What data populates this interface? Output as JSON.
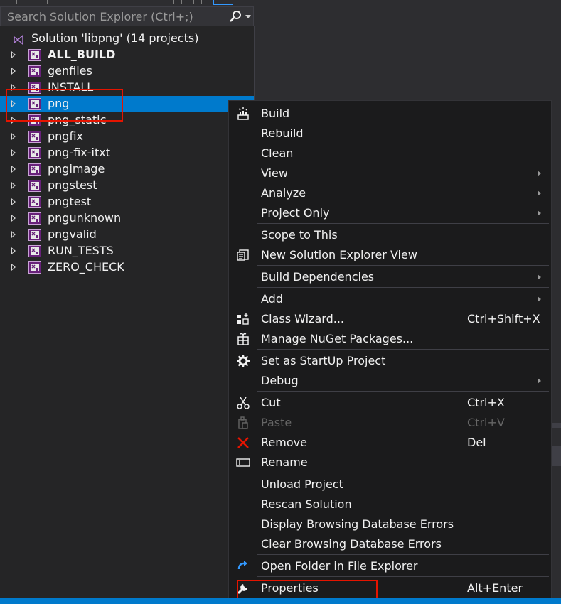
{
  "search": {
    "placeholder": "Search Solution Explorer (Ctrl+;)"
  },
  "solution": {
    "label": "Solution 'libpng' (14 projects)",
    "icon": "visual-studio-solution-icon"
  },
  "projects": [
    {
      "label": "ALL_BUILD",
      "bold": true
    },
    {
      "label": "genfiles"
    },
    {
      "label": "INSTALL"
    },
    {
      "label": "png",
      "selected": true
    },
    {
      "label": "png_static"
    },
    {
      "label": "pngfix"
    },
    {
      "label": "png-fix-itxt"
    },
    {
      "label": "pngimage"
    },
    {
      "label": "pngstest"
    },
    {
      "label": "pngtest"
    },
    {
      "label": "pngunknown"
    },
    {
      "label": "pngvalid"
    },
    {
      "label": "RUN_TESTS"
    },
    {
      "label": "ZERO_CHECK"
    }
  ],
  "context_menu": {
    "items": [
      {
        "label": "Build",
        "icon": "build-icon"
      },
      {
        "label": "Rebuild"
      },
      {
        "label": "Clean"
      },
      {
        "label": "View",
        "submenu": true
      },
      {
        "label": "Analyze",
        "submenu": true
      },
      {
        "label": "Project Only",
        "submenu": true
      },
      {
        "label": "Scope to This"
      },
      {
        "label": "New Solution Explorer View",
        "icon": "new-view-icon"
      },
      {
        "label": "Build Dependencies",
        "submenu": true
      },
      {
        "label": "Add",
        "submenu": true
      },
      {
        "label": "Class Wizard...",
        "shortcut": "Ctrl+Shift+X",
        "icon": "class-wizard-icon"
      },
      {
        "label": "Manage NuGet Packages...",
        "icon": "nuget-icon"
      },
      {
        "label": "Set as StartUp Project",
        "icon": "gear-icon"
      },
      {
        "label": "Debug",
        "submenu": true
      },
      {
        "label": "Cut",
        "shortcut": "Ctrl+X",
        "icon": "scissors-icon"
      },
      {
        "label": "Paste",
        "shortcut": "Ctrl+V",
        "disabled": true,
        "icon": "paste-icon"
      },
      {
        "label": "Remove",
        "shortcut": "Del",
        "icon": "remove-x-icon"
      },
      {
        "label": "Rename",
        "icon": "rename-icon"
      },
      {
        "label": "Unload Project"
      },
      {
        "label": "Rescan Solution"
      },
      {
        "label": "Display Browsing Database Errors"
      },
      {
        "label": "Clear Browsing Database Errors"
      },
      {
        "label": "Open Folder in File Explorer",
        "icon": "refresh-arrow-icon"
      },
      {
        "label": "Properties",
        "shortcut": "Alt+Enter",
        "icon": "wrench-icon"
      }
    ]
  },
  "colors": {
    "selection": "#007acc",
    "annotation_box": "#e51400",
    "remove_icon": "#e51400",
    "open_folder_icon": "#3399ff"
  }
}
